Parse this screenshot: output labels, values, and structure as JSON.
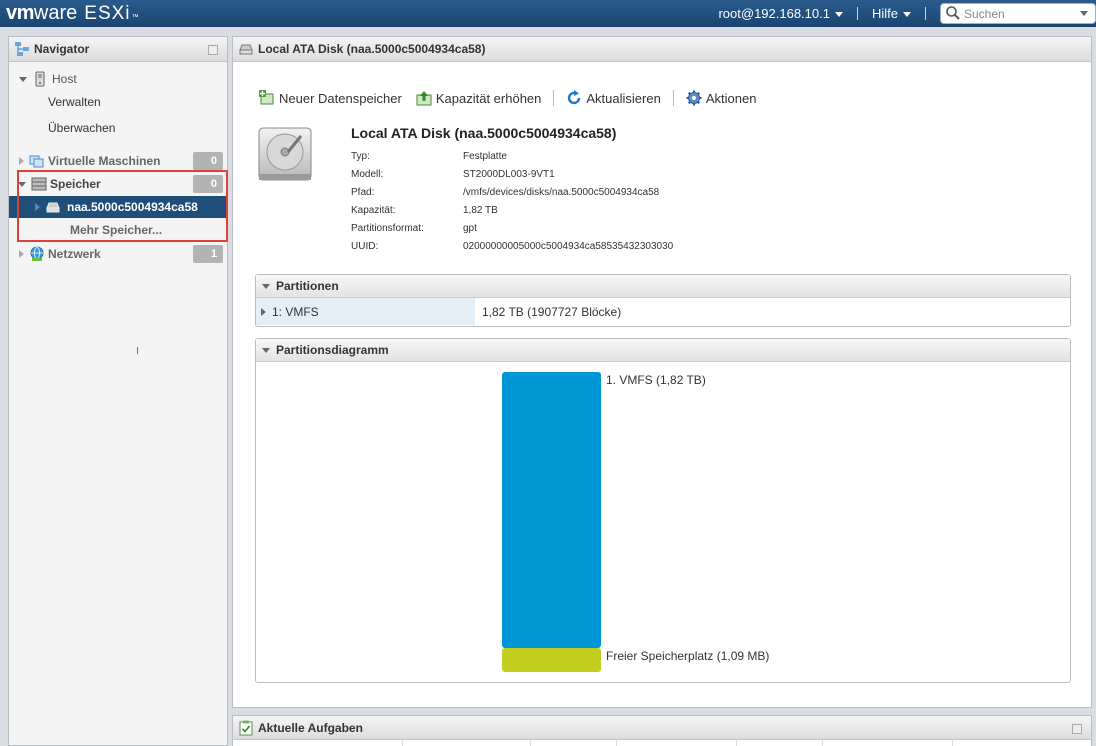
{
  "brand": {
    "vm": "vm",
    "ware": "ware",
    "product": "ESXi",
    "tm": "™"
  },
  "topbar": {
    "user_menu": "root@192.168.10.1",
    "help_menu": "Hilfe",
    "search_placeholder": "Suchen"
  },
  "navigator": {
    "title": "Navigator",
    "items": [
      {
        "label": "Host",
        "icon": "host-icon",
        "expanded": true
      },
      {
        "label": "Verwalten"
      },
      {
        "label": "Überwachen"
      },
      {
        "label": "Virtuelle Maschinen",
        "icon": "vm-icon",
        "badge": "0"
      },
      {
        "label": "Speicher",
        "icon": "storage-icon",
        "badge": "0",
        "expanded": true
      },
      {
        "label": "naa.5000c5004934ca58",
        "icon": "disk-icon",
        "selected": true
      },
      {
        "label": "Mehr Speicher..."
      },
      {
        "label": "Netzwerk",
        "icon": "network-icon",
        "badge": "1"
      }
    ]
  },
  "main": {
    "header_title": "Local ATA Disk (naa.5000c5004934ca58)",
    "toolbar": {
      "new_datastore": "Neuer Datenspeicher",
      "increase_capacity": "Kapazität erhöhen",
      "refresh": "Aktualisieren",
      "actions": "Aktionen"
    },
    "disk": {
      "title": "Local ATA Disk (naa.5000c5004934ca58)",
      "props": [
        {
          "label": "Typ:",
          "value": "Festplatte"
        },
        {
          "label": "Modell:",
          "value": "ST2000DL003-9VT1"
        },
        {
          "label": "Pfad:",
          "value": "/vmfs/devices/disks/naa.5000c5004934ca58"
        },
        {
          "label": "Kapazität:",
          "value": "1,82 TB"
        },
        {
          "label": "Partitionsformat:",
          "value": "gpt"
        },
        {
          "label": "UUID:",
          "value": "02000000005000c5004934ca58535432303030"
        }
      ]
    },
    "partitions": {
      "title": "Partitionen",
      "rows": [
        {
          "name": "1: VMFS",
          "size": "1,82 TB (1907727 Blöcke)"
        }
      ]
    },
    "diagram": {
      "title": "Partitionsdiagramm",
      "segments": [
        {
          "label": "1. VMFS  (1,82 TB)",
          "fraction": 0.92,
          "color": "#0096d6"
        },
        {
          "label": "Freier Speicherplatz  (1,09 MB)",
          "fraction": 0.08,
          "color": "#c2cf1e"
        }
      ]
    }
  },
  "tasks": {
    "title": "Aktuelle Aufgaben"
  }
}
